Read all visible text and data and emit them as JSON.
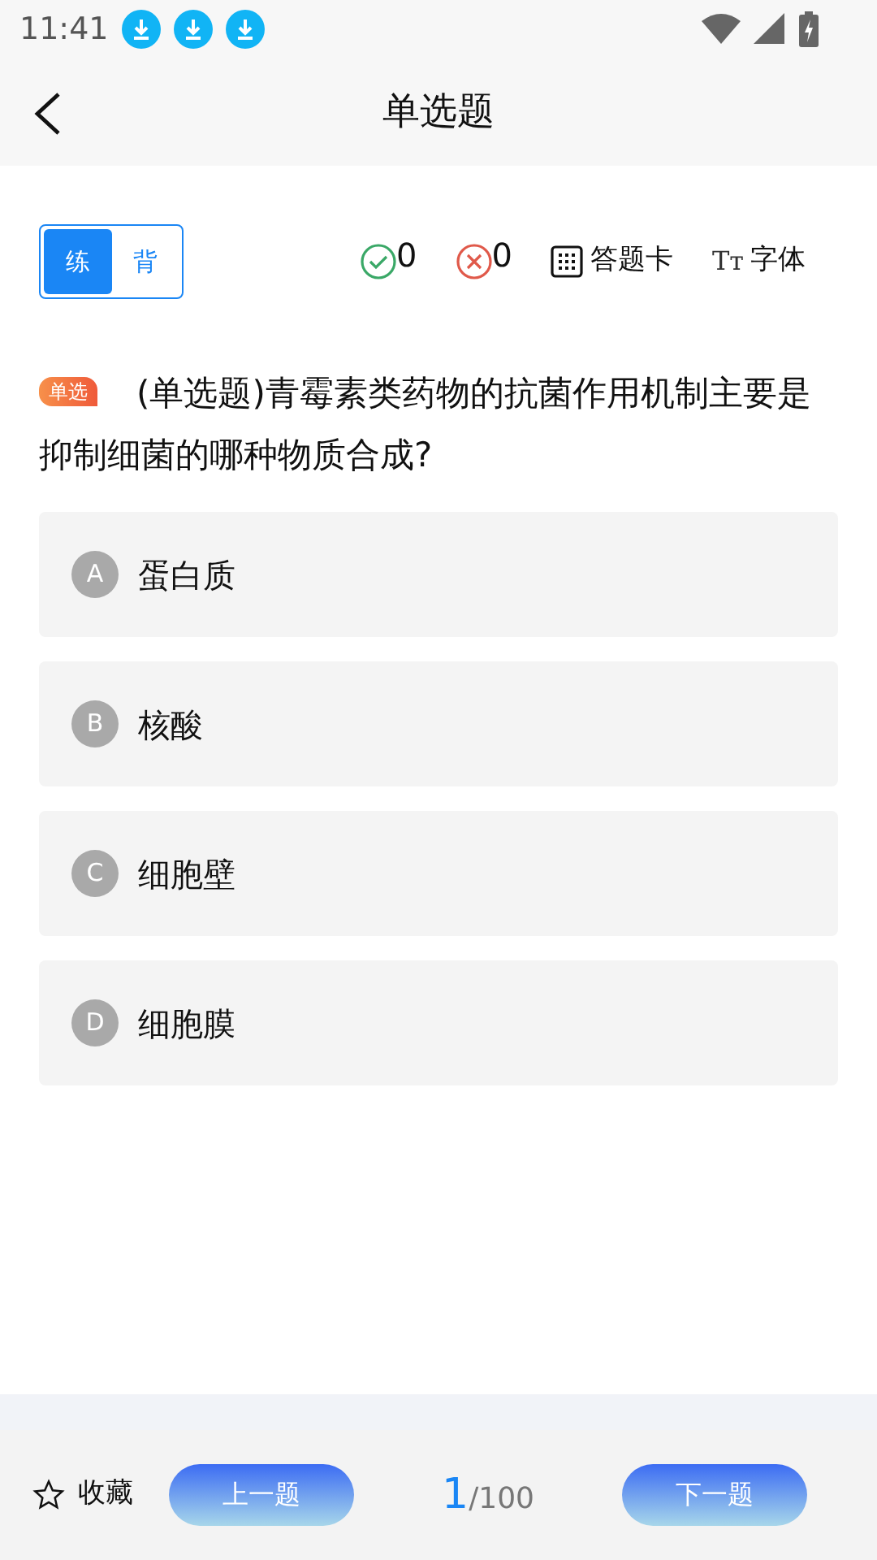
{
  "status_bar": {
    "time": "11:41"
  },
  "header": {
    "title": "单选题"
  },
  "mode_toggle": [
    {
      "label": "练",
      "selected": true
    },
    {
      "label": "背",
      "selected": false
    }
  ],
  "stats": {
    "correct": "0",
    "wrong": "0",
    "answer_card": "答题卡",
    "font": "字体",
    "font_icon": "Tт"
  },
  "question": {
    "tag": "单选",
    "text": "(单选题)青霉素类药物的抗菌作用机制主要是抑制细菌的哪种物质合成?"
  },
  "options": [
    {
      "letter": "A",
      "text": "蛋白质"
    },
    {
      "letter": "B",
      "text": "核酸"
    },
    {
      "letter": "C",
      "text": "细胞壁"
    },
    {
      "letter": "D",
      "text": "细胞膜"
    }
  ],
  "footer": {
    "favorite": "收藏",
    "prev": "上一题",
    "current": "1",
    "total": "/100",
    "next": "下一题"
  }
}
